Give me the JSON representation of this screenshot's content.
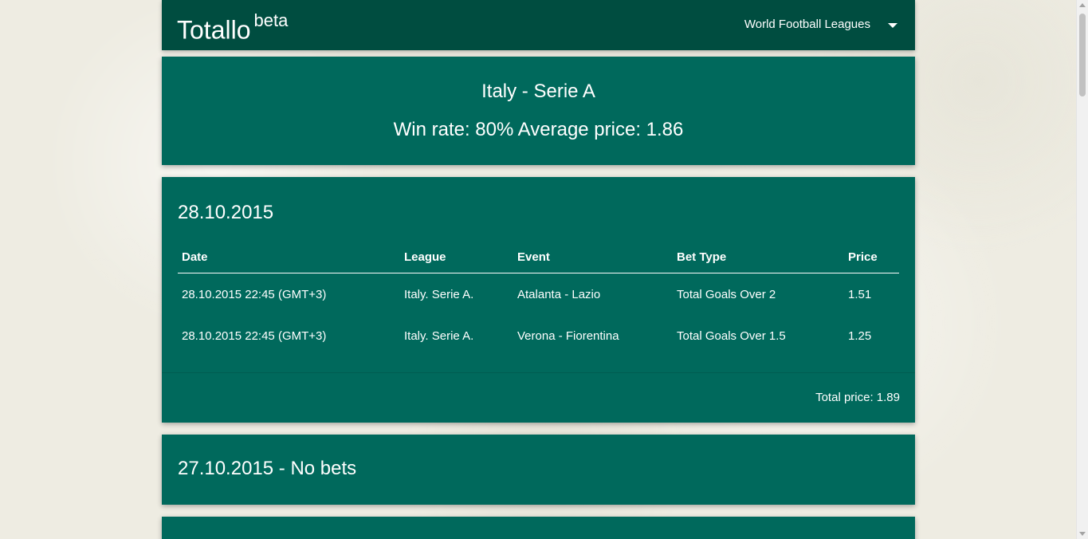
{
  "navbar": {
    "brand": "Totallo",
    "brand_sup": "beta",
    "dropdown_label": "World Football Leagues",
    "dropdown_icon": "caret-down-icon"
  },
  "summary": {
    "league": "Italy - Serie A",
    "stats": "Win rate: 80% Average price: 1.86"
  },
  "days": [
    {
      "title": "28.10.2015",
      "columns": [
        "Date",
        "League",
        "Event",
        "Bet Type",
        "Price"
      ],
      "rows": [
        [
          "28.10.2015 22:45 (GMT+3)",
          "Italy. Serie A.",
          "Atalanta - Lazio",
          "Total Goals Over 2",
          "1.51"
        ],
        [
          "28.10.2015 22:45 (GMT+3)",
          "Italy. Serie A.",
          "Verona - Fiorentina",
          "Total Goals Over 1.5",
          "1.25"
        ]
      ],
      "total": "Total price: 1.89"
    },
    {
      "title": "27.10.2015 - No bets"
    }
  ],
  "colors": {
    "navbar": "#004d40",
    "card": "#00695c",
    "background": "#eeece2"
  }
}
